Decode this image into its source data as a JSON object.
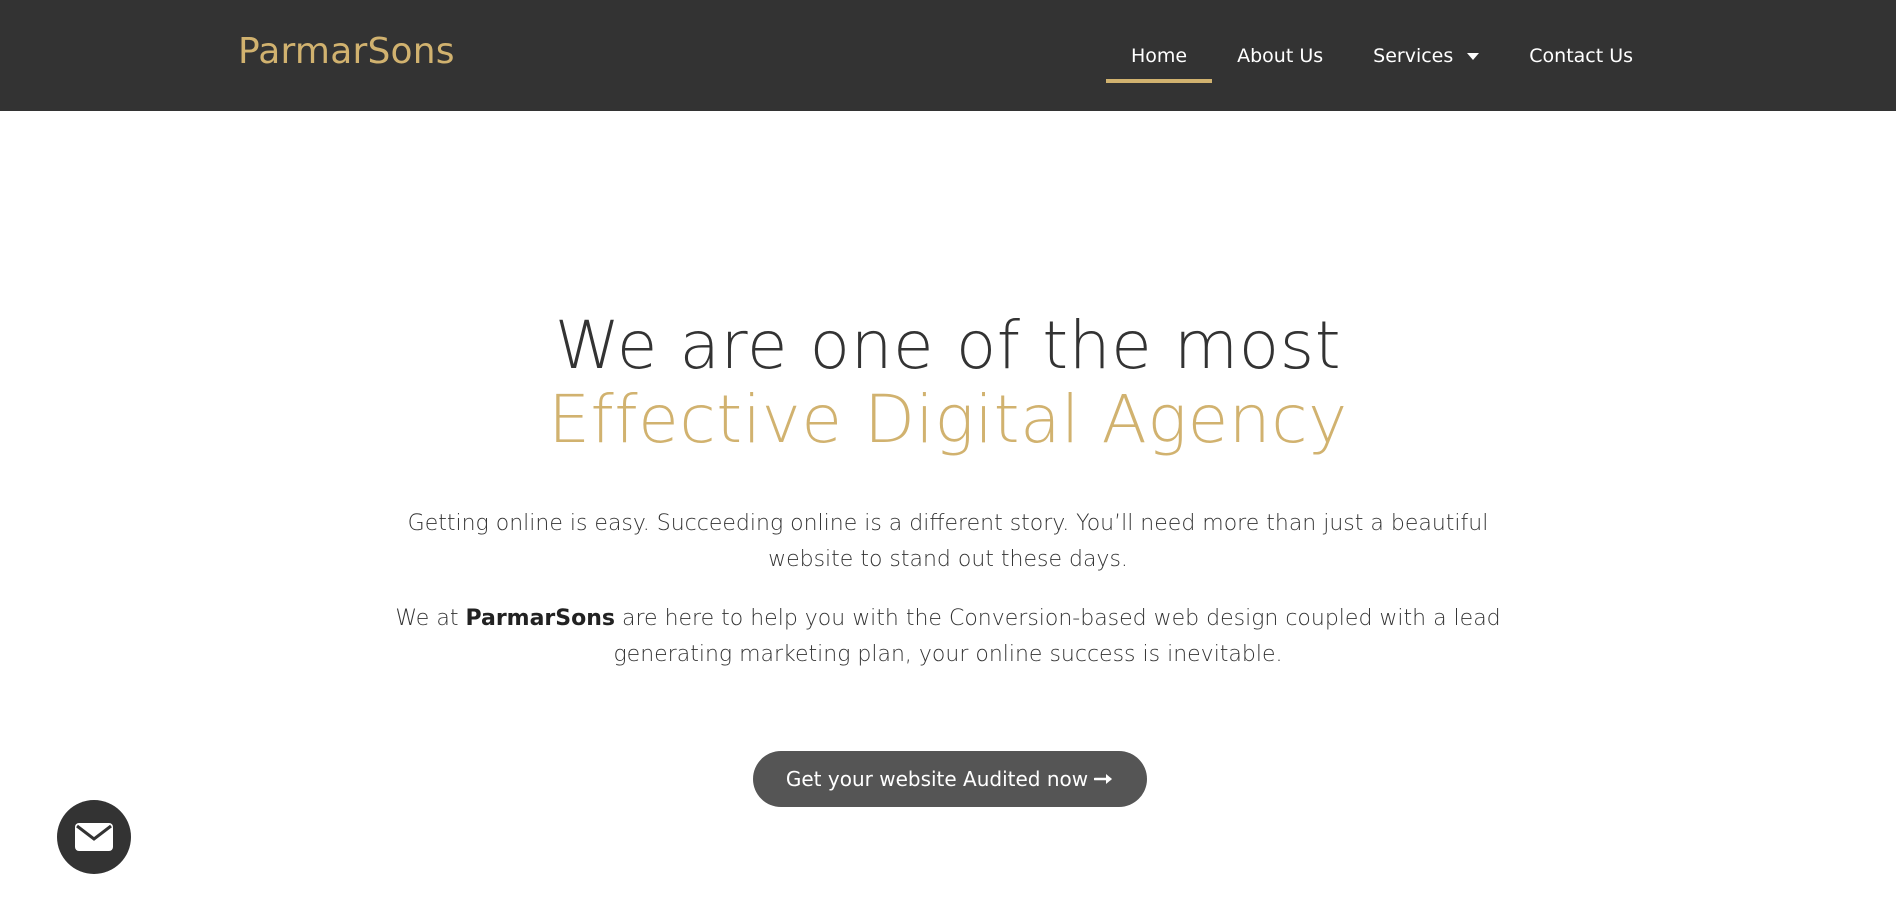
{
  "brand": {
    "name": "ParmarSons"
  },
  "nav": {
    "items": [
      {
        "label": "Home",
        "active": true
      },
      {
        "label": "About Us"
      },
      {
        "label": "Services",
        "has_dropdown": true
      },
      {
        "label": "Contact Us"
      }
    ]
  },
  "hero": {
    "headline_line1": "We are one of the most",
    "headline_line2": "Effective Digital Agency",
    "paragraph1": "Getting online is easy.  Succeeding online is a different story.  You’ll need more than just a beautiful website to stand out these days.",
    "paragraph2_prefix": "We at ",
    "paragraph2_brand": "ParmarSons",
    "paragraph2_suffix": " are here to help you with the Conversion-based web design coupled with a lead generating marketing plan, your online success is inevitable.",
    "cta_label": "Get your website Audited now",
    "cta_icon": "long-arrow-right-icon"
  },
  "floating": {
    "icon": "envelope-icon"
  },
  "colors": {
    "header_bg": "#333333",
    "accent_gold": "#d1b26f",
    "button_bg": "#555555"
  }
}
